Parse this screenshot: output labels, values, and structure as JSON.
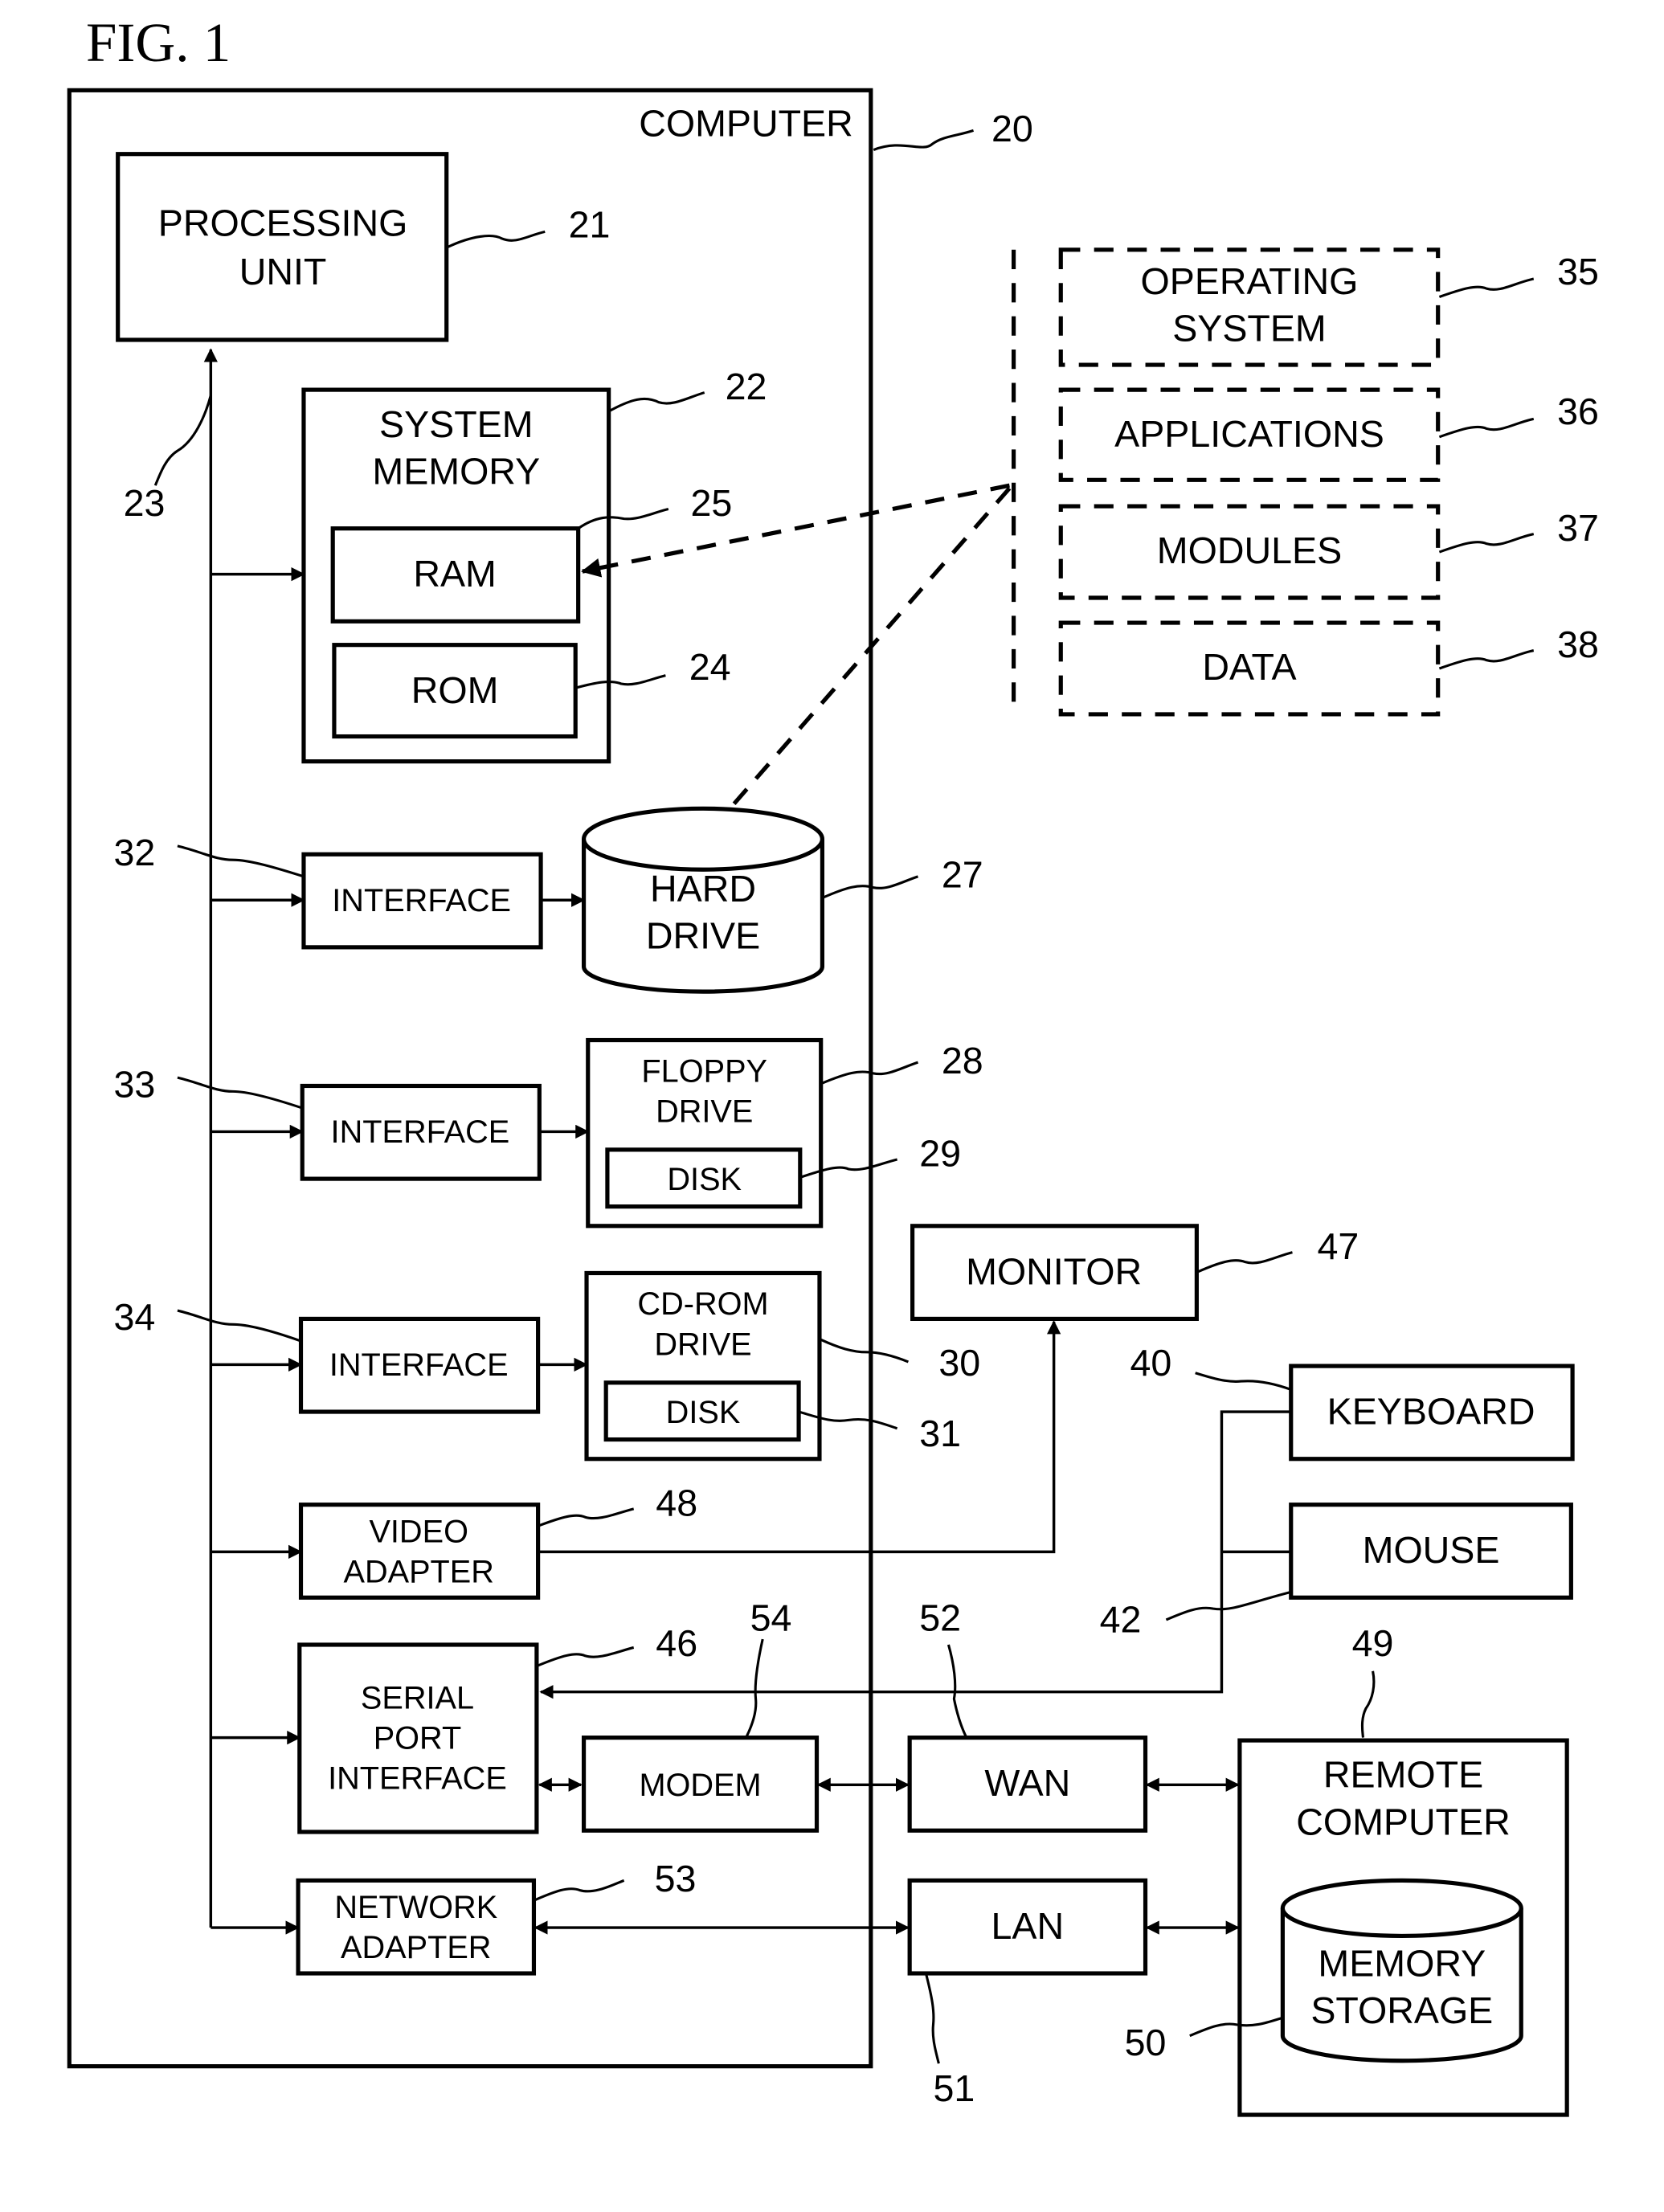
{
  "figure_title": "FIG. 1",
  "computer": {
    "label": "COMPUTER",
    "ref": "20"
  },
  "processing_unit": {
    "lines": [
      "PROCESSING",
      "UNIT"
    ],
    "ref": "21"
  },
  "system_bus": {
    "ref": "23"
  },
  "system_memory": {
    "lines": [
      "SYSTEM",
      "MEMORY"
    ],
    "ref": "22",
    "ram": {
      "label": "RAM",
      "ref": "25"
    },
    "rom": {
      "label": "ROM",
      "ref": "24"
    }
  },
  "software": [
    {
      "lines": [
        "OPERATING",
        "SYSTEM"
      ],
      "ref": "35"
    },
    {
      "lines": [
        "APPLICATIONS"
      ],
      "ref": "36"
    },
    {
      "lines": [
        "MODULES"
      ],
      "ref": "37"
    },
    {
      "lines": [
        "DATA"
      ],
      "ref": "38"
    }
  ],
  "interfaces": [
    {
      "label": "INTERFACE",
      "ref": "32"
    },
    {
      "label": "INTERFACE",
      "ref": "33"
    },
    {
      "label": "INTERFACE",
      "ref": "34"
    }
  ],
  "hard_drive": {
    "lines": [
      "HARD",
      "DRIVE"
    ],
    "ref": "27"
  },
  "floppy_drive": {
    "lines": [
      "FLOPPY",
      "DRIVE"
    ],
    "ref": "28",
    "disk": {
      "label": "DISK",
      "ref": "29"
    }
  },
  "cdrom_drive": {
    "lines": [
      "CD-ROM",
      "DRIVE"
    ],
    "ref": "30",
    "disk": {
      "label": "DISK",
      "ref": "31"
    }
  },
  "video_adapter": {
    "lines": [
      "VIDEO",
      "ADAPTER"
    ],
    "ref": "48"
  },
  "monitor": {
    "label": "MONITOR",
    "ref": "47"
  },
  "keyboard": {
    "label": "KEYBOARD",
    "ref": "40"
  },
  "mouse": {
    "label": "MOUSE",
    "ref": "42"
  },
  "serial_port": {
    "lines": [
      "SERIAL",
      "PORT",
      "INTERFACE"
    ],
    "ref": "46"
  },
  "modem": {
    "label": "MODEM",
    "ref": "54"
  },
  "wan": {
    "label": "WAN",
    "ref": "52"
  },
  "network_adapter": {
    "lines": [
      "NETWORK",
      "ADAPTER"
    ],
    "ref": "53"
  },
  "lan": {
    "label": "LAN",
    "ref": "51"
  },
  "remote_computer": {
    "lines": [
      "REMOTE",
      "COMPUTER"
    ],
    "ref": "49",
    "memory_storage": {
      "lines": [
        "MEMORY",
        "STORAGE"
      ],
      "ref": "50"
    }
  }
}
